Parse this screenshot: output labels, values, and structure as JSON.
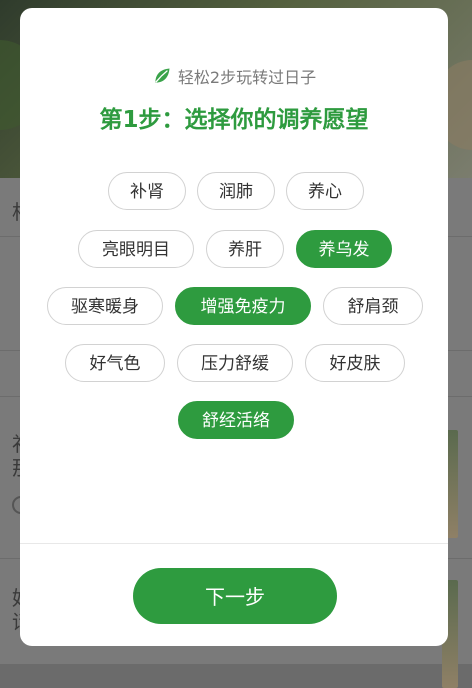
{
  "background": {
    "left_chars": [
      "相",
      "补",
      "那",
      "好",
      "话"
    ]
  },
  "modal": {
    "subtitle": "轻松2步玩转过日子",
    "subtitle_icon": "leaf-icon",
    "title": "第1步：选择你的调养愿望",
    "tags": [
      {
        "label": "补肾",
        "selected": false
      },
      {
        "label": "润肺",
        "selected": false
      },
      {
        "label": "养心",
        "selected": false
      },
      {
        "label": "亮眼明目",
        "selected": false
      },
      {
        "label": "养肝",
        "selected": false
      },
      {
        "label": "养乌发",
        "selected": true
      },
      {
        "label": "驱寒暖身",
        "selected": false
      },
      {
        "label": "增强免疫力",
        "selected": true
      },
      {
        "label": "舒肩颈",
        "selected": false
      },
      {
        "label": "好气色",
        "selected": false
      },
      {
        "label": "压力舒缓",
        "selected": false
      },
      {
        "label": "好皮肤",
        "selected": false
      },
      {
        "label": "舒经活络",
        "selected": true
      }
    ],
    "next_button_label": "下一步"
  },
  "colors": {
    "accent": "#2e9b3f",
    "tag_border": "#d2d2d2",
    "overlay": "#7a7a7a"
  }
}
